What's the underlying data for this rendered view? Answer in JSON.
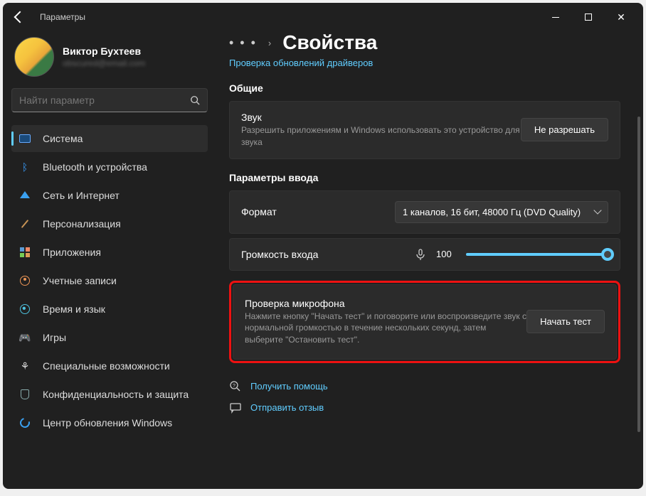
{
  "window": {
    "title": "Параметры"
  },
  "user": {
    "name": "Виктор Бухтеев",
    "email": "obscured@email.com"
  },
  "search": {
    "placeholder": "Найти параметр"
  },
  "nav": {
    "items": [
      {
        "label": "Система",
        "icon": "system-icon"
      },
      {
        "label": "Bluetooth и устройства",
        "icon": "bluetooth-icon"
      },
      {
        "label": "Сеть и Интернет",
        "icon": "network-icon"
      },
      {
        "label": "Персонализация",
        "icon": "personalization-icon"
      },
      {
        "label": "Приложения",
        "icon": "apps-icon"
      },
      {
        "label": "Учетные записи",
        "icon": "accounts-icon"
      },
      {
        "label": "Время и язык",
        "icon": "time-icon"
      },
      {
        "label": "Игры",
        "icon": "games-icon"
      },
      {
        "label": "Специальные возможности",
        "icon": "accessibility-icon"
      },
      {
        "label": "Конфиденциальность и защита",
        "icon": "privacy-icon"
      },
      {
        "label": "Центр обновления Windows",
        "icon": "update-icon"
      }
    ]
  },
  "breadcrumb": {
    "dots": "• • •",
    "chev": "›",
    "title": "Свойства"
  },
  "driver_link": "Проверка обновлений драйверов",
  "sections": {
    "general": {
      "title": "Общие",
      "sound": {
        "title": "Звук",
        "desc": "Разрешить приложениям и Windows использовать это устройство для звука",
        "button": "Не разрешать"
      }
    },
    "input": {
      "title": "Параметры ввода",
      "format": {
        "label": "Формат",
        "value": "1 каналов, 16 бит, 48000 Гц (DVD Quality)"
      },
      "volume": {
        "label": "Громкость входа",
        "value": "100"
      },
      "test": {
        "title": "Проверка микрофона",
        "desc": "Нажмите кнопку \"Начать тест\" и поговорите или воспроизведите звук с нормальной громкостью в течение нескольких секунд, затем выберите \"Остановить тест\".",
        "button": "Начать тест"
      }
    }
  },
  "footer": {
    "help": "Получить помощь",
    "feedback": "Отправить отзыв"
  }
}
